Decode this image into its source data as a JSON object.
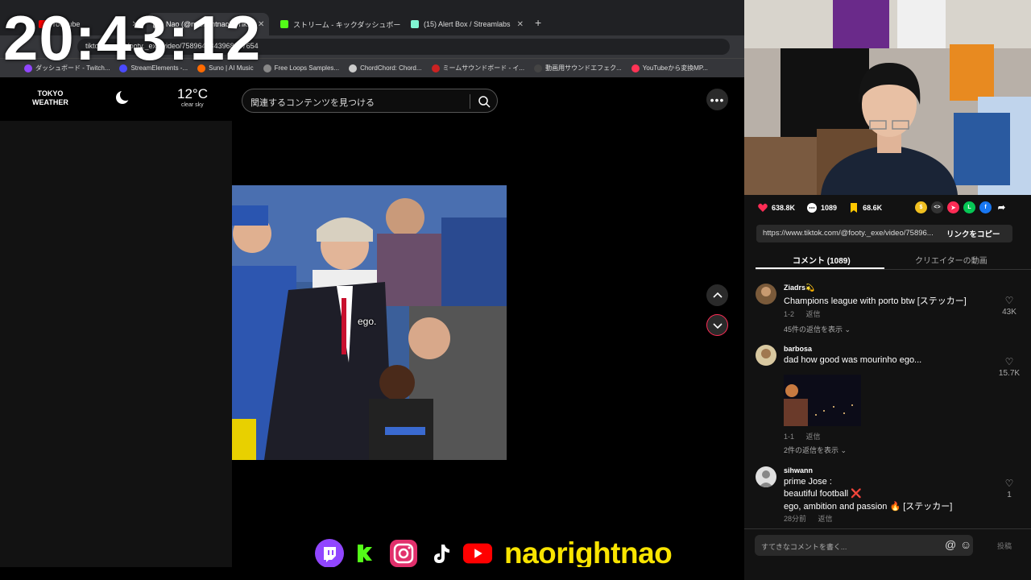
{
  "clock": "20:43:12",
  "browser": {
    "tabs": [
      {
        "label": "YouTube",
        "icon": "youtube-icon",
        "color": "#ff0000"
      },
      {
        "label": "Nao (@naorightnao) | Tik...",
        "icon": "tiktok-icon",
        "color": "#ffffff",
        "active": true
      },
      {
        "label": "ストリーム - キックダッシュボード",
        "icon": "kick-icon",
        "color": "#53fc18"
      },
      {
        "label": "(15) Alert Box / Streamlabs",
        "icon": "streamlabs-icon",
        "color": "#80f5d2"
      }
    ],
    "address": "tiktok.com/@footy._exe/video/7589645843968997654",
    "bookmarks": [
      {
        "label": "ダッシュボード - Twitch...",
        "color": "#9146ff"
      },
      {
        "label": "StreamElements -...",
        "color": "#4a4aff"
      },
      {
        "label": "Suno | AI Music",
        "color": "#ff6a00"
      },
      {
        "label": "Free Loops Samples...",
        "color": "#888888"
      },
      {
        "label": "ChordChord: Chord...",
        "color": "#cccccc"
      },
      {
        "label": "ミームサウンドボード - イ...",
        "color": "#cc2222"
      },
      {
        "label": "動画用サウンドエフェク...",
        "color": "#444444"
      },
      {
        "label": "YouTubeから変換MP...",
        "color": "#ff3355"
      }
    ]
  },
  "weather": {
    "city": "TOKYO",
    "label": "WEATHER",
    "temp": "12°C",
    "desc": "clear sky"
  },
  "search": {
    "placeholder": "関連するコンテンツを見つける"
  },
  "video": {
    "subtitle": "ego."
  },
  "social": {
    "handle": "naorightnao",
    "icons": [
      "twitch-icon",
      "kick-icon",
      "instagram-icon",
      "tiktok-icon",
      "youtube-icon"
    ]
  },
  "actions": {
    "likes": "638.8K",
    "comments": "1089",
    "saves": "68.6K"
  },
  "link": {
    "url": "https://www.tiktok.com/@footy._exe/video/75896...",
    "copy": "リンクをコピー"
  },
  "tabs": {
    "comments": "コメント (1089)",
    "creator": "クリエイターの動画"
  },
  "comments": [
    {
      "user": "Ziadrs💫",
      "text": "Champions league with porto btw [ステッカー]",
      "date": "1-2",
      "reply": "返信",
      "replies": "45件の返信を表示",
      "likes": "43K"
    },
    {
      "user": "barbosa",
      "text": "dad how good was mourinho ego...",
      "date": "1-1",
      "reply": "返信",
      "replies": "2件の返信を表示",
      "likes": "15.7K"
    },
    {
      "user": "sihwann",
      "lines": [
        "prime Jose :",
        "beautiful football ❌",
        "ego, ambition and passion 🔥 [ステッカー]"
      ],
      "date": "28分前",
      "reply": "返信",
      "likes": "1"
    }
  ],
  "input": {
    "placeholder": "すてきなコメントを書く...",
    "post": "投稿"
  },
  "colors": {
    "accent": "#fe2c55",
    "handle": "#f9e400"
  }
}
